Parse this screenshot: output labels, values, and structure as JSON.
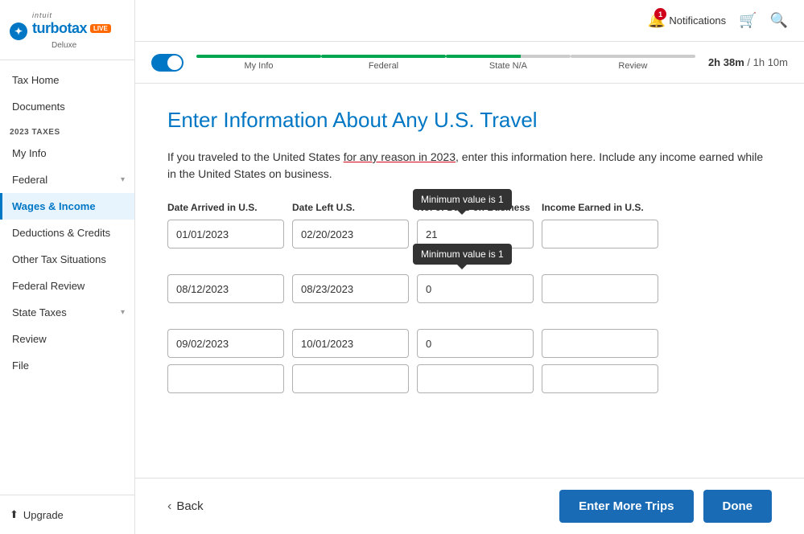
{
  "sidebar": {
    "logo": {
      "intuit": "intuit",
      "turbotax": "turbotax",
      "live": "LIVE",
      "deluxe": "Deluxe"
    },
    "section_label": "2023 TAXES",
    "items": [
      {
        "id": "tax-home",
        "label": "Tax Home",
        "active": false,
        "has_chevron": false
      },
      {
        "id": "documents",
        "label": "Documents",
        "active": false,
        "has_chevron": false
      },
      {
        "id": "my-info",
        "label": "My Info",
        "active": false,
        "has_chevron": false
      },
      {
        "id": "federal",
        "label": "Federal",
        "active": false,
        "has_chevron": true
      },
      {
        "id": "wages-income",
        "label": "Wages & Income",
        "active": true,
        "has_chevron": false
      },
      {
        "id": "deductions-credits",
        "label": "Deductions & Credits",
        "active": false,
        "has_chevron": false
      },
      {
        "id": "other-tax",
        "label": "Other Tax Situations",
        "active": false,
        "has_chevron": false
      },
      {
        "id": "federal-review",
        "label": "Federal Review",
        "active": false,
        "has_chevron": false
      },
      {
        "id": "state-taxes",
        "label": "State Taxes",
        "active": false,
        "has_chevron": true
      },
      {
        "id": "review",
        "label": "Review",
        "active": false,
        "has_chevron": false
      },
      {
        "id": "file",
        "label": "File",
        "active": false,
        "has_chevron": false
      }
    ],
    "footer": {
      "upgrade_label": "Upgrade"
    }
  },
  "topbar": {
    "notifications_label": "Notifications",
    "notifications_count": "1"
  },
  "progress": {
    "steps": [
      {
        "id": "my-info",
        "label": "My Info",
        "state": "complete"
      },
      {
        "id": "federal",
        "label": "Federal",
        "state": "complete"
      },
      {
        "id": "state",
        "label": "State N/A",
        "state": "partial"
      },
      {
        "id": "review",
        "label": "Review",
        "state": "inactive"
      }
    ],
    "time_estimate": "2h 38m",
    "time_divider": "/",
    "time_remaining": "1h 10m"
  },
  "page": {
    "title": "Enter Information About Any U.S. Travel",
    "description_part1": "If you traveled to the United States ",
    "description_underline": "for any reason in 2023",
    "description_part2": ", enter this information here. Include any income earned while in the United States on business."
  },
  "table": {
    "headers": [
      "Date Arrived in U.S.",
      "Date Left U.S.",
      "No. of Days on Business",
      "Income Earned in U.S."
    ],
    "rows": [
      {
        "arrive": "01/01/2023",
        "depart": "02/20/2023",
        "days": "21",
        "income": ""
      },
      {
        "arrive": "08/12/2023",
        "depart": "08/23/2023",
        "days": "0",
        "income": ""
      },
      {
        "arrive": "09/02/2023",
        "depart": "10/01/2023",
        "days": "0",
        "income": ""
      },
      {
        "arrive": "",
        "depart": "",
        "days": "",
        "income": ""
      }
    ],
    "tooltips": {
      "row1": "Minimum value is 1",
      "row2": "Minimum value is 1"
    }
  },
  "buttons": {
    "back": "Back",
    "enter_more_trips": "Enter More Trips",
    "done": "Done"
  }
}
